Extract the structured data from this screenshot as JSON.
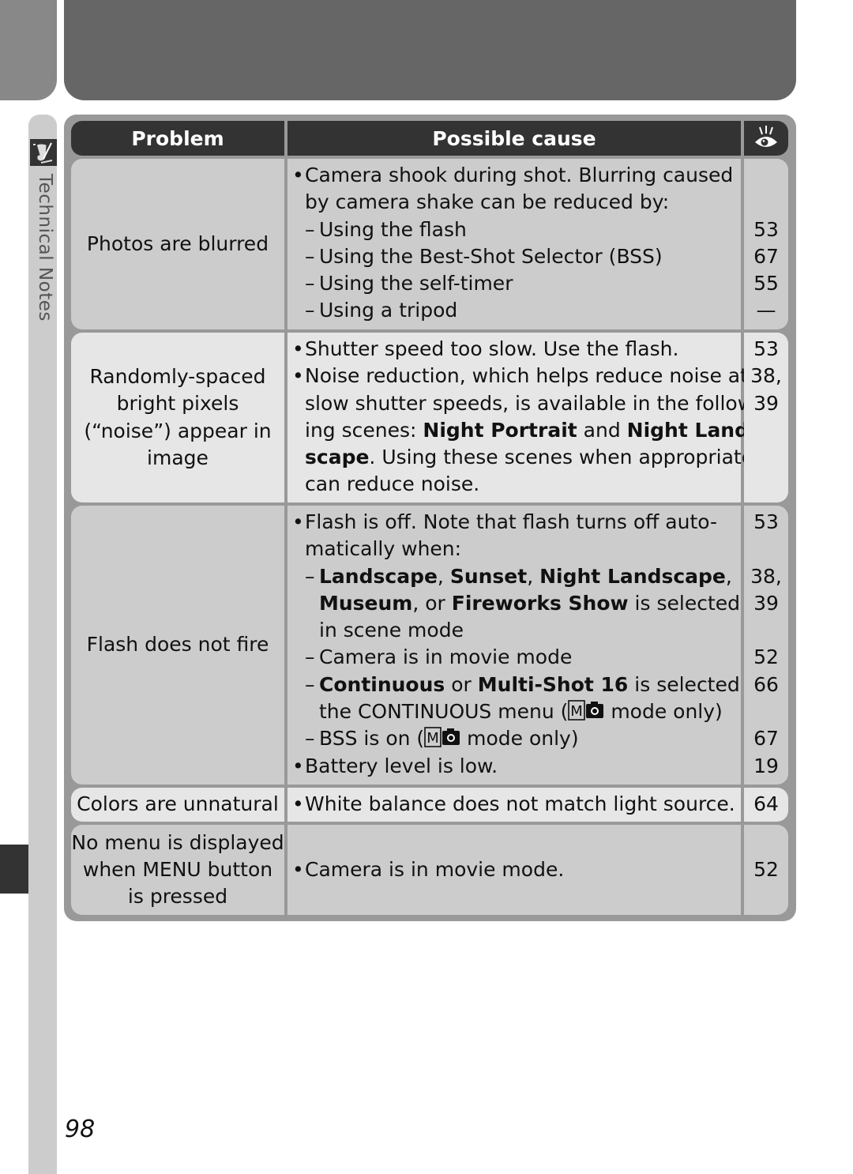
{
  "section": {
    "label": "Technical Notes",
    "icon": "technical-notes-quill-icon"
  },
  "table": {
    "headers": {
      "problem": "Problem",
      "cause": "Possible cause",
      "page_icon": "eye-reference-icon"
    },
    "rows": [
      {
        "problem": "Photos are blurred",
        "shade": "dark",
        "lines": [
          {
            "type": "bullet",
            "text": "Camera shook during shot.  Blurring caused",
            "page": ""
          },
          {
            "type": "cont",
            "text": "by camera shake can be reduced by:",
            "page": ""
          },
          {
            "type": "dash",
            "text": "Using the flash",
            "page": "53"
          },
          {
            "type": "dash",
            "text": "Using the Best-Shot Selector (BSS)",
            "page": "67"
          },
          {
            "type": "dash",
            "text": "Using the self-timer",
            "page": "55"
          },
          {
            "type": "dash",
            "text": "Using a tripod",
            "page": "—"
          }
        ]
      },
      {
        "problem_lines": [
          "Randomly-spaced",
          "bright pixels",
          "(“noise”) appear in",
          "image"
        ],
        "shade": "light",
        "lines": [
          {
            "type": "bullet",
            "text": "Shutter speed too slow.  Use the flash.",
            "page": "53"
          },
          {
            "type": "bullet",
            "text": "Noise reduction, which helps reduce noise at",
            "page": "38,"
          },
          {
            "type": "cont",
            "text": "slow shutter speeds, is available in the follow-",
            "page": "39"
          },
          {
            "type": "cont",
            "parts": [
              "ing scenes: ",
              "Night Portrait",
              " and ",
              "Night Land-"
            ],
            "page": ""
          },
          {
            "type": "cont",
            "parts": [
              "scape",
              ".  Using these scenes when appropriate"
            ],
            "page": ""
          },
          {
            "type": "cont",
            "text": "can reduce noise.",
            "page": ""
          }
        ]
      },
      {
        "problem": "Flash does not fire",
        "shade": "dark",
        "lines": [
          {
            "type": "bullet",
            "text": "Flash is off.  Note that flash turns off auto-",
            "page": "53"
          },
          {
            "type": "cont",
            "text": "matically when:",
            "page": ""
          },
          {
            "type": "dash",
            "parts": [
              "Landscape",
              ", ",
              "Sunset",
              ", ",
              "Night Landscape",
              ","
            ],
            "page": "38,"
          },
          {
            "type": "cont2",
            "parts": [
              "Museum",
              ", or ",
              "Fireworks Show",
              " is selected"
            ],
            "page": "39"
          },
          {
            "type": "cont2",
            "text": "in scene mode",
            "page": ""
          },
          {
            "type": "dash",
            "text": "Camera is in movie mode",
            "page": "52"
          },
          {
            "type": "dash",
            "parts": [
              "Continuous",
              " or ",
              "Multi-Shot 16",
              " is selected in"
            ],
            "page": "66"
          },
          {
            "type": "cont2",
            "pre": "the CONTINUOUS menu (",
            "post": " mode only)",
            "page": ""
          },
          {
            "type": "dash",
            "pre": "BSS is on (",
            "post": " mode only)",
            "page": "67"
          },
          {
            "type": "bullet",
            "text": "Battery level is low.",
            "page": "19"
          }
        ]
      },
      {
        "problem": "Colors are unnatural",
        "shade": "light",
        "lines": [
          {
            "type": "bullet",
            "text": "White balance does not match light source.",
            "page": "64"
          }
        ]
      },
      {
        "problem_lines": [
          "No menu is displayed",
          "when MENU button",
          "is pressed"
        ],
        "shade": "dark",
        "lines": [
          {
            "type": "bullet",
            "text": "Camera is in movie mode.",
            "page": "52"
          }
        ]
      }
    ]
  },
  "mode_icon": "manual-camera-mode-icon",
  "page_number": "98"
}
